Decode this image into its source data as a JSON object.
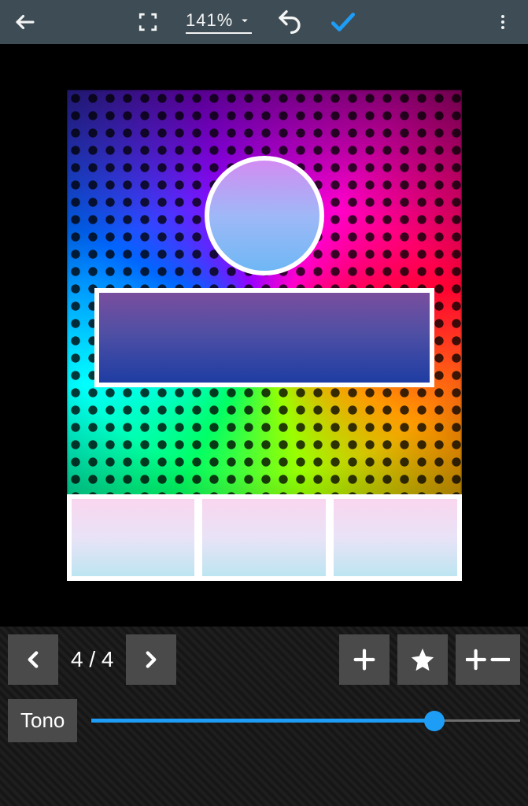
{
  "topbar": {
    "zoom_label": "141%"
  },
  "pager": {
    "current": 4,
    "total": 4,
    "display": "4 / 4"
  },
  "adjust": {
    "label": "Tono",
    "slider_value": 80
  },
  "icons": {
    "back": "back-arrow-icon",
    "fullscreen": "fullscreen-icon",
    "dropdown": "chevron-down-icon",
    "undo": "undo-icon",
    "confirm": "checkmark-icon",
    "overflow": "more-vertical-icon",
    "prev": "chevron-left-icon",
    "next": "chevron-right-icon",
    "plus": "plus-icon",
    "star": "star-icon",
    "plusminus": "plus-minus-icon"
  }
}
